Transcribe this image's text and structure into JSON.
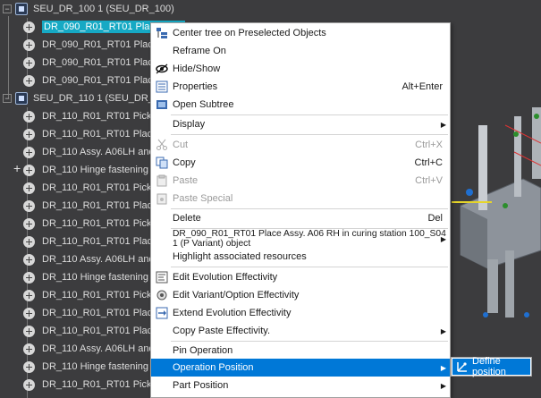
{
  "tree": {
    "nodes": [
      {
        "label": "SEU_DR_100 1 (SEU_DR_100)",
        "kind": "group"
      },
      {
        "label": "DR_090_R01_RT01 Place Assy. A06 RH in curing station 100_S04 1 (P Variant) object",
        "kind": "op",
        "selected": true
      },
      {
        "label": "DR_090_R01_RT01 Place Assy.",
        "kind": "op"
      },
      {
        "label": "DR_090_R01_RT01 Place Assy.",
        "kind": "op"
      },
      {
        "label": "DR_090_R01_RT01 Place Assy.",
        "kind": "op"
      },
      {
        "label": "SEU_DR_110 1 (SEU_DR_110)",
        "kind": "group"
      },
      {
        "label": "DR_110_R01_RT01 Pick Assy. A",
        "kind": "op"
      },
      {
        "label": "DR_110_R01_RT01 Place Assy",
        "kind": "op"
      },
      {
        "label": "DR_110 Assy. A06LH and hin",
        "kind": "op"
      },
      {
        "label": "DR_110 Hinge fastening 1 (P",
        "kind": "op"
      },
      {
        "label": "DR_110_R01_RT01 Pick Assy. A",
        "kind": "op"
      },
      {
        "label": "DR_110_R01_RT01 Place Assy",
        "kind": "op"
      },
      {
        "label": "DR_110_R01_RT01 Pick Assy. A",
        "kind": "op"
      },
      {
        "label": "DR_110_R01_RT01 Place Assy",
        "kind": "op"
      },
      {
        "label": "DR_110 Assy. A06LH and hin",
        "kind": "op"
      },
      {
        "label": "DR_110 Hinge fastening 1 (G",
        "kind": "op"
      },
      {
        "label": "DR_110_R01_RT01 Pick Assy. A",
        "kind": "op"
      },
      {
        "label": "DR_110_R01_RT01 Place Assy",
        "kind": "op"
      },
      {
        "label": "DR_110_R01_RT01 Place Assy",
        "kind": "op"
      },
      {
        "label": "DR_110 Assy. A06LH and hin",
        "kind": "op"
      },
      {
        "label": "DR_110 Hinge fastening 1 (R",
        "kind": "op"
      },
      {
        "label": "DR_110_R01_RT01 Pick Assy. A",
        "kind": "op"
      },
      {
        "label": "DR_110_R01_RT01 Pick Assy. A",
        "kind": "op"
      }
    ]
  },
  "menu": {
    "items": [
      {
        "label": "Center tree on Preselected Objects",
        "shortcut": "",
        "icon": "center-tree-icon"
      },
      {
        "label": "Reframe On",
        "shortcut": "",
        "icon": ""
      },
      {
        "label": "Hide/Show",
        "shortcut": "",
        "icon": "eye-icon"
      },
      {
        "label": "Properties",
        "shortcut": "Alt+Enter",
        "icon": "properties-icon"
      },
      {
        "label": "Open Subtree",
        "shortcut": "",
        "icon": "open-subtree-icon"
      },
      {
        "label": "Display",
        "shortcut": "",
        "icon": ""
      },
      {
        "label": "Cut",
        "shortcut": "Ctrl+X",
        "icon": "scissors-icon"
      },
      {
        "label": "Copy",
        "shortcut": "Ctrl+C",
        "icon": "copy-icon"
      },
      {
        "label": "Paste",
        "shortcut": "Ctrl+V",
        "icon": "paste-icon"
      },
      {
        "label": "Paste Special",
        "shortcut": "",
        "icon": "paste-special-icon"
      },
      {
        "label": "Delete",
        "shortcut": "Del",
        "icon": ""
      },
      {
        "label": "DR_090_R01_RT01 Place Assy. A06 RH in curing station 100_S04  1 (P Variant) object",
        "shortcut": "",
        "icon": ""
      },
      {
        "label": "Highlight associated resources",
        "shortcut": "",
        "icon": ""
      },
      {
        "label": "Edit Evolution Effectivity",
        "shortcut": "",
        "icon": "edit-evolution-icon"
      },
      {
        "label": "Edit Variant/Option Effectivity",
        "shortcut": "",
        "icon": "edit-variant-icon"
      },
      {
        "label": "Extend Evolution Effectivity",
        "shortcut": "",
        "icon": "extend-evolution-icon"
      },
      {
        "label": "Copy Paste Effectivity.",
        "shortcut": "",
        "icon": ""
      },
      {
        "label": "Pin Operation",
        "shortcut": "",
        "icon": ""
      },
      {
        "label": "Operation Position",
        "shortcut": "",
        "icon": ""
      },
      {
        "label": "Part Position",
        "shortcut": "",
        "icon": ""
      }
    ]
  },
  "submenu": {
    "label": "Define position",
    "icon": "define-position-icon"
  },
  "colors": {
    "menu_highlight": "#0078d7",
    "tree_selection": "#16a9c4",
    "background": "#3c3c3e"
  }
}
